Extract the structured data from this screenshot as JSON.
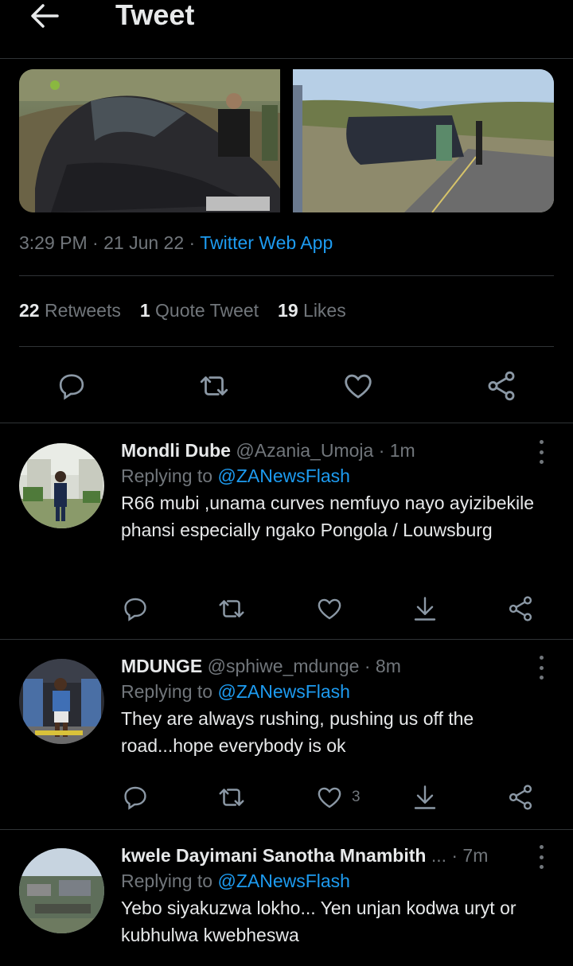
{
  "header": {
    "title": "Tweet"
  },
  "tweet": {
    "time": "3:29 PM",
    "date": "21 Jun 22",
    "source": "Twitter Web App",
    "sep": "·",
    "stats": {
      "retweets_count": "22",
      "retweets_label": "Retweets",
      "quotes_count": "1",
      "quotes_label": "Quote Tweet",
      "likes_count": "19",
      "likes_label": "Likes"
    }
  },
  "colors": {
    "background": "#000000",
    "text": "#e7e9ea",
    "muted": "#71767b",
    "accent": "#1d9bf0",
    "divider": "#2f3336"
  },
  "icons": [
    "back-arrow-icon",
    "reply-icon",
    "retweet-icon",
    "like-icon",
    "share-icon",
    "more-icon",
    "download-icon"
  ],
  "replies": [
    {
      "name": "Mondli Dube",
      "handle": "@Azania_Umoja",
      "time": "· 1m",
      "replying_prefix": "Replying to",
      "replying_to": "@ZANewsFlash",
      "text": "R66 mubi ,unama curves nemfuyo nayo ayizibekile phansi especially ngako Pongola / Louwsburg",
      "likes": ""
    },
    {
      "name": "MDUNGE",
      "handle": "@sphiwe_mdunge",
      "time": "· 8m",
      "replying_prefix": "Replying to",
      "replying_to": "@ZANewsFlash",
      "text": "They are always rushing, pushing us off the road...hope everybody is ok",
      "likes": "3"
    },
    {
      "name": "kwele Dayimani Sanotha Mnambith",
      "handle": "...",
      "time": "· 7m",
      "replying_prefix": "Replying to",
      "replying_to": "@ZANewsFlash",
      "text": "Yebo siyakuzwa lokho... Yen unjan kodwa uryt or kubhulwa kwebheswa",
      "likes": ""
    }
  ]
}
